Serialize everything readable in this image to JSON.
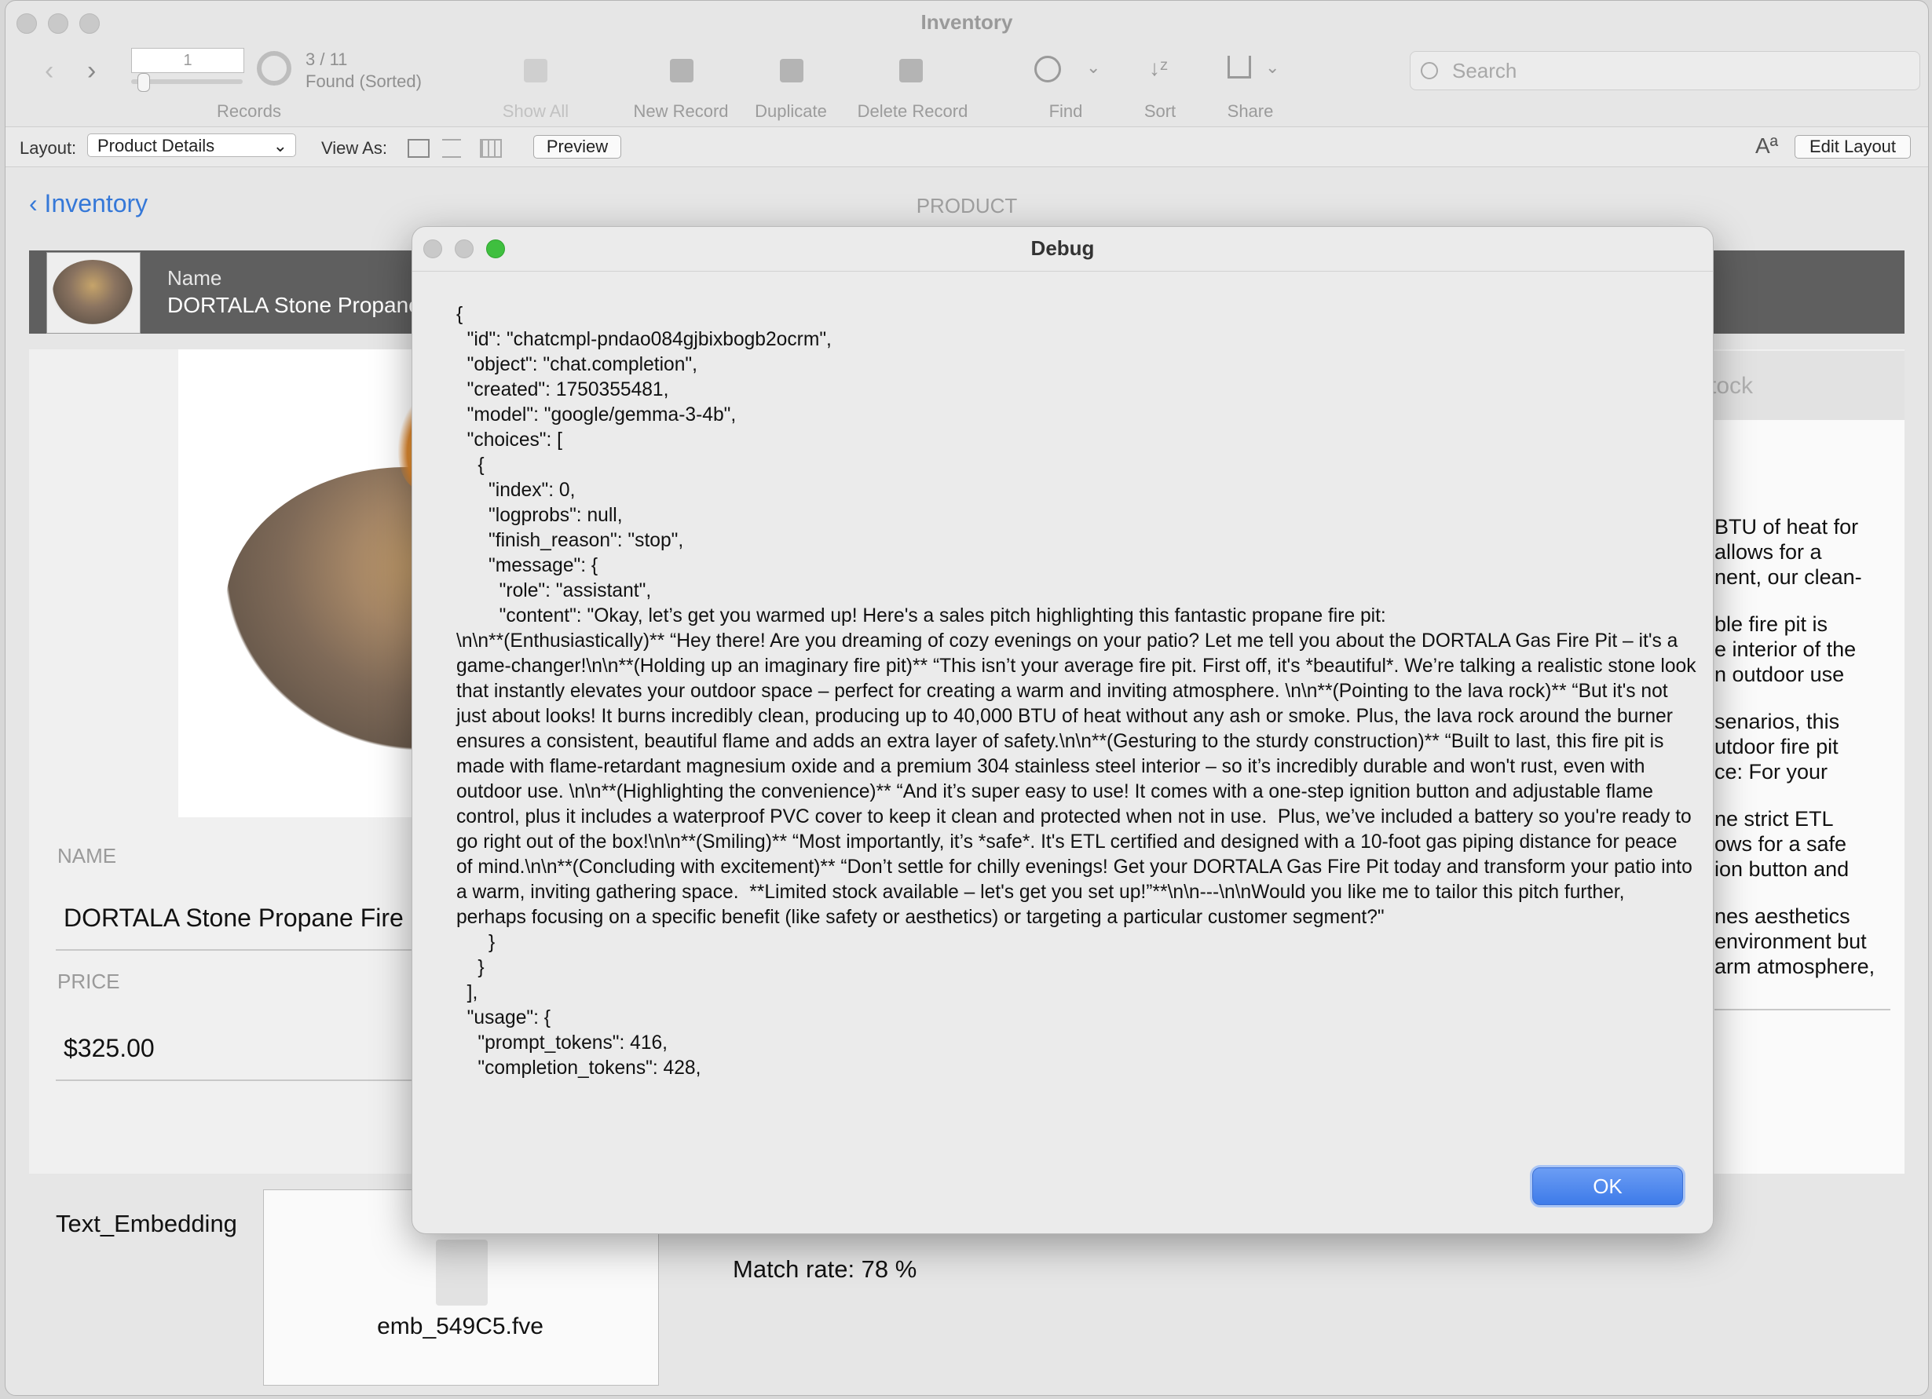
{
  "window": {
    "title": "Inventory"
  },
  "toolbar": {
    "record_number": "1",
    "found_count": "3 / 11",
    "found_status": "Found (Sorted)",
    "records_label": "Records",
    "show_all_label": "Show All",
    "new_record_label": "New Record",
    "duplicate_label": "Duplicate",
    "delete_record_label": "Delete Record",
    "find_label": "Find",
    "sort_label": "Sort",
    "share_label": "Share",
    "search_placeholder": "Search"
  },
  "layout_bar": {
    "layout_label": "Layout:",
    "layout_value": "Product Details",
    "view_as_label": "View As:",
    "preview_label": "Preview",
    "font_size_glyph": "Aª",
    "edit_layout_label": "Edit Layout"
  },
  "header": {
    "back_label": "Inventory",
    "layout_heading": "PRODUCT"
  },
  "product": {
    "name_label_bar": "Name",
    "name_bar_value": "DORTALA Stone Propane",
    "name_label": "NAME",
    "name_value": "DORTALA Stone Propane Fire",
    "price_label": "PRICE",
    "price_value": "$325.00",
    "stock_tab": "tock",
    "description_lines": [
      "BTU of heat for",
      " allows for a",
      "nent, our clean-",
      "ble fire pit is",
      "e interior of the",
      "n outdoor use",
      " senarios, this",
      "utdoor fire pit",
      "ce: For your",
      "ne strict ETL",
      "ows for a safe",
      "ion button and",
      "nes aesthetics",
      "environment but",
      "arm atmosphere,"
    ]
  },
  "embedding": {
    "label": "Text_Embedding",
    "file_name": "emb_549C5.fve",
    "match_rate": "Match rate: 78 %"
  },
  "dialog": {
    "title": "Debug",
    "content": "{\n  \"id\": \"chatcmpl-pndao084gjbixbogb2ocrm\",\n  \"object\": \"chat.completion\",\n  \"created\": 1750355481,\n  \"model\": \"google/gemma-3-4b\",\n  \"choices\": [\n    {\n      \"index\": 0,\n      \"logprobs\": null,\n      \"finish_reason\": \"stop\",\n      \"message\": {\n        \"role\": \"assistant\",\n        \"content\": \"Okay, let’s get you warmed up! Here's a sales pitch highlighting this fantastic propane fire pit:\n\\n\\n**(Enthusiastically)** “Hey there! Are you dreaming of cozy evenings on your patio? Let me tell you about the DORTALA Gas Fire Pit – it's a game-changer!\\n\\n**(Holding up an imaginary fire pit)** “This isn’t your average fire pit. First off, it's *beautiful*. We’re talking a realistic stone look that instantly elevates your outdoor space – perfect for creating a warm and inviting atmosphere. \\n\\n**(Pointing to the lava rock)** “But it's not just about looks! It burns incredibly clean, producing up to 40,000 BTU of heat without any ash or smoke. Plus, the lava rock around the burner ensures a consistent, beautiful flame and adds an extra layer of safety.\\n\\n**(Gesturing to the sturdy construction)** “Built to last, this fire pit is made with flame-retardant magnesium oxide and a premium 304 stainless steel interior – so it’s incredibly durable and won't rust, even with outdoor use. \\n\\n**(Highlighting the convenience)** “And it’s super easy to use! It comes with a one-step ignition button and adjustable flame control, plus it includes a waterproof PVC cover to keep it clean and protected when not in use.  Plus, we’ve included a battery so you're ready to go right out of the box!\\n\\n**(Smiling)** “Most importantly, it’s *safe*. It's ETL certified and designed with a 10-foot gas piping distance for peace of mind.\\n\\n**(Concluding with excitement)** “Don’t settle for chilly evenings! Get your DORTALA Gas Fire Pit today and transform your patio into a warm, inviting gathering space.  **Limited stock available – let's get you set up!”**\\n\\n---\\n\\nWould you like me to tailor this pitch further, perhaps focusing on a specific benefit (like safety or aesthetics) or targeting a particular customer segment?\"\n      }\n    }\n  ],\n  \"usage\": {\n    \"prompt_tokens\": 416,\n    \"completion_tokens\": 428,",
    "ok_label": "OK"
  },
  "colors": {
    "accent": "#3578d8",
    "ok_button": "#4a86ee",
    "name_bar": "#5f5f5f"
  },
  "icons": [
    "back-icon",
    "forward-icon",
    "show-all-icon",
    "new-record-icon",
    "duplicate-icon",
    "delete-record-icon",
    "search-icon",
    "sort-icon",
    "share-icon",
    "form-view-icon",
    "list-view-icon",
    "table-view-icon",
    "font-size-icon",
    "file-icon",
    "chevron-left-icon"
  ]
}
